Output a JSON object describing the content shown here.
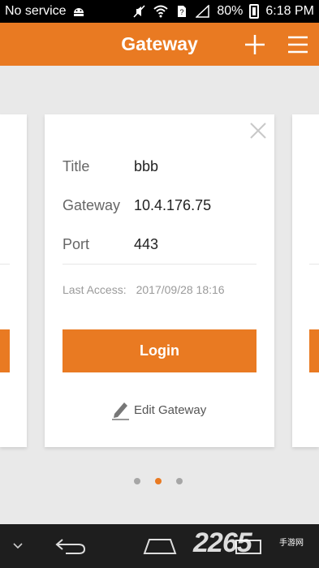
{
  "status_bar": {
    "carrier": "No service",
    "battery": "80%",
    "time": "6:18 PM"
  },
  "header": {
    "title": "Gateway"
  },
  "gateway_card": {
    "fields": [
      {
        "label": "Title",
        "value": "bbb"
      },
      {
        "label": "Gateway",
        "value": "10.4.176.75"
      },
      {
        "label": "Port",
        "value": "443"
      }
    ],
    "last_access_label": "Last Access:",
    "last_access_value": "2017/09/28 18:16",
    "login_label": "Login",
    "edit_label": "Edit Gateway"
  },
  "pagination": {
    "total": 3,
    "active_index": 1
  },
  "colors": {
    "accent": "#e97a22",
    "background": "#e9e9e9"
  },
  "watermark": {
    "text": "2265",
    "sub": "手游网"
  }
}
